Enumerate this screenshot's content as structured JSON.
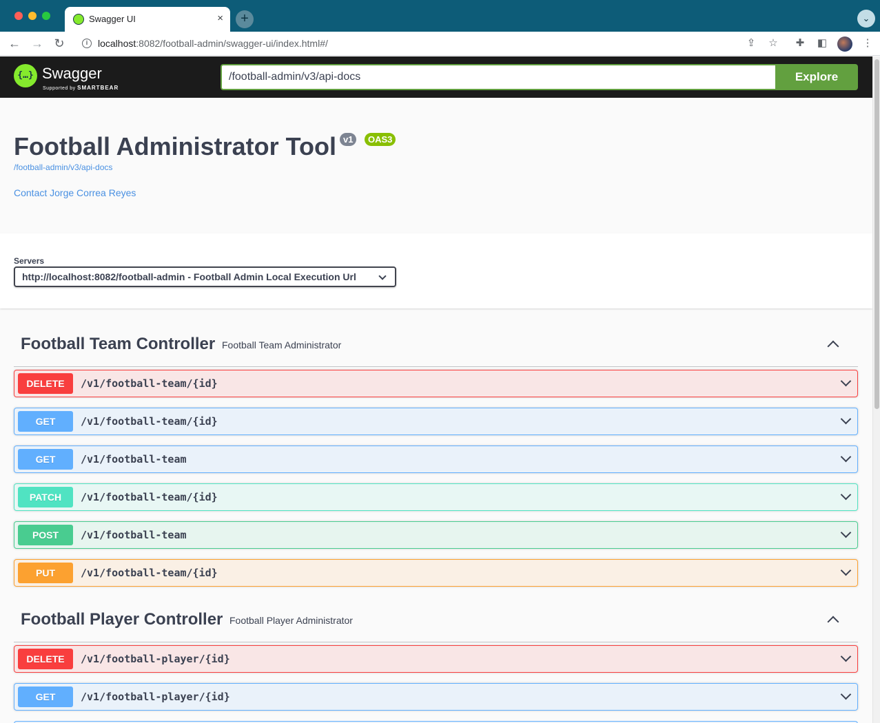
{
  "browser": {
    "tab_title": "Swagger UI",
    "tab_close": "×",
    "new_tab": "+",
    "url_host": "localhost",
    "url_rest": ":8082/football-admin/swagger-ui/index.html#/"
  },
  "swagger": {
    "logo_text": "Swagger",
    "logo_sub_prefix": "Supported by",
    "logo_sub_brand": "SMARTBEAR",
    "spec_url": "/football-admin/v3/api-docs",
    "explore_label": "Explore"
  },
  "info": {
    "title": "Football Administrator Tool",
    "version_badge": "v1",
    "oas_badge": "OAS3",
    "spec_link": "/football-admin/v3/api-docs",
    "contact": "Contact Jorge Correa Reyes"
  },
  "servers": {
    "label": "Servers",
    "selected": "http://localhost:8082/football-admin - Football Admin Local Execution Url"
  },
  "tags": [
    {
      "name": "Football Team Controller",
      "description": "Football Team Administrator",
      "operations": [
        {
          "method": "DELETE",
          "path": "/v1/football-team/{id}"
        },
        {
          "method": "GET",
          "path": "/v1/football-team/{id}"
        },
        {
          "method": "GET",
          "path": "/v1/football-team"
        },
        {
          "method": "PATCH",
          "path": "/v1/football-team/{id}"
        },
        {
          "method": "POST",
          "path": "/v1/football-team"
        },
        {
          "method": "PUT",
          "path": "/v1/football-team/{id}"
        }
      ]
    },
    {
      "name": "Football Player Controller",
      "description": "Football Player Administrator",
      "operations": [
        {
          "method": "DELETE",
          "path": "/v1/football-player/{id}"
        },
        {
          "method": "GET",
          "path": "/v1/football-player/{id}"
        }
      ]
    }
  ],
  "colors": {
    "delete": "#f93e3e",
    "get": "#61affe",
    "patch": "#50e3c2",
    "post": "#49cc90",
    "put": "#fca130",
    "explore": "#62a03f",
    "link": "#4990e2"
  }
}
